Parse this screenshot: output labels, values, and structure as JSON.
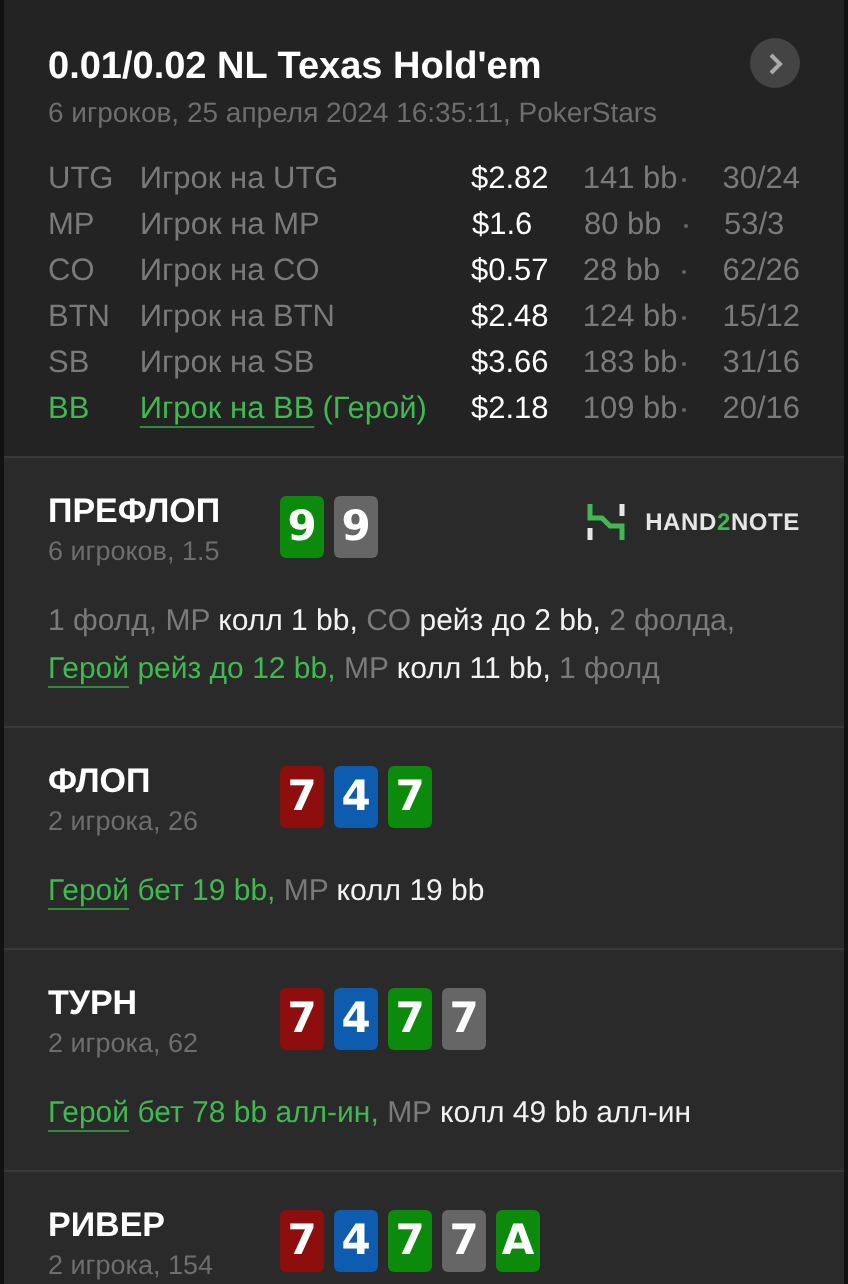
{
  "header": {
    "title": "0.01/0.02 NL Texas Hold'em",
    "subtitle": "6 игроков, 25 апреля 2024 16:35:11, PokerStars"
  },
  "players": [
    {
      "position": "UTG",
      "name": "Игрок на UTG",
      "hero": false,
      "stack": "$2.82",
      "bb": "141 bb",
      "stats": "30/24"
    },
    {
      "position": "MP",
      "name": "Игрок на MP",
      "hero": false,
      "stack": "$1.6",
      "bb": "80 bb",
      "stats": "53/3"
    },
    {
      "position": "CO",
      "name": "Игрок на CO",
      "hero": false,
      "stack": "$0.57",
      "bb": "28 bb",
      "stats": "62/26"
    },
    {
      "position": "BTN",
      "name": "Игрок на BTN",
      "hero": false,
      "stack": "$2.48",
      "bb": "124 bb",
      "stats": "15/12"
    },
    {
      "position": "SB",
      "name": "Игрок на SB",
      "hero": false,
      "stack": "$3.66",
      "bb": "183 bb",
      "stats": "31/16"
    },
    {
      "position": "BB",
      "name": "Игрок на BB",
      "hero": true,
      "hero_label": "(Герой)",
      "stack": "$2.18",
      "bb": "109 bb",
      "stats": "20/16"
    }
  ],
  "streets": [
    {
      "title": "ПРЕФЛОП",
      "subtitle": "6 игроков, 1.5",
      "logo": [
        "HAND",
        "2",
        "NOTE"
      ],
      "cards": [
        {
          "rank": "9",
          "color": "#0b8a0b"
        },
        {
          "rank": "9",
          "color": "#666666"
        }
      ],
      "actions": [
        {
          "kind": "muted",
          "text": "1 фолд, MP "
        },
        {
          "kind": "action",
          "text": "колл 1 bb, "
        },
        {
          "kind": "muted",
          "text": "CO "
        },
        {
          "kind": "action",
          "text": "рейз до 2 bb, "
        },
        {
          "kind": "muted",
          "text": "2 фолда, "
        },
        {
          "kind": "hero_link",
          "text": "Герой"
        },
        {
          "kind": "hero",
          "text": " рейз до 12 bb, "
        },
        {
          "kind": "muted",
          "text": "MP "
        },
        {
          "kind": "action",
          "text": "колл 11 bb, "
        },
        {
          "kind": "muted",
          "text": "1 фолд"
        }
      ]
    },
    {
      "title": "ФЛОП",
      "subtitle": "2 игрока, 26",
      "cards": [
        {
          "rank": "7",
          "color": "#8e0e0e"
        },
        {
          "rank": "4",
          "color": "#0d5cb0"
        },
        {
          "rank": "7",
          "color": "#0b8a0b"
        }
      ],
      "actions": [
        {
          "kind": "hero_link",
          "text": "Герой"
        },
        {
          "kind": "hero",
          "text": " бет 19 bb, "
        },
        {
          "kind": "muted",
          "text": "MP "
        },
        {
          "kind": "action",
          "text": "колл 19 bb"
        }
      ]
    },
    {
      "title": "ТУРН",
      "subtitle": "2 игрока, 62",
      "cards": [
        {
          "rank": "7",
          "color": "#8e0e0e"
        },
        {
          "rank": "4",
          "color": "#0d5cb0"
        },
        {
          "rank": "7",
          "color": "#0b8a0b"
        },
        {
          "rank": "7",
          "color": "#666666"
        }
      ],
      "actions": [
        {
          "kind": "hero_link",
          "text": "Герой"
        },
        {
          "kind": "hero",
          "text": " бет 78 bb алл-ин, "
        },
        {
          "kind": "muted",
          "text": "MP "
        },
        {
          "kind": "action",
          "text": "колл 49 bb алл-ин"
        }
      ]
    },
    {
      "title": "РИВЕР",
      "subtitle": "2 игрока, 154",
      "cards": [
        {
          "rank": "7",
          "color": "#8e0e0e"
        },
        {
          "rank": "4",
          "color": "#0d5cb0"
        },
        {
          "rank": "7",
          "color": "#0b8a0b"
        },
        {
          "rank": "7",
          "color": "#666666"
        },
        {
          "rank": "A",
          "color": "#0b8a0b"
        }
      ]
    }
  ]
}
